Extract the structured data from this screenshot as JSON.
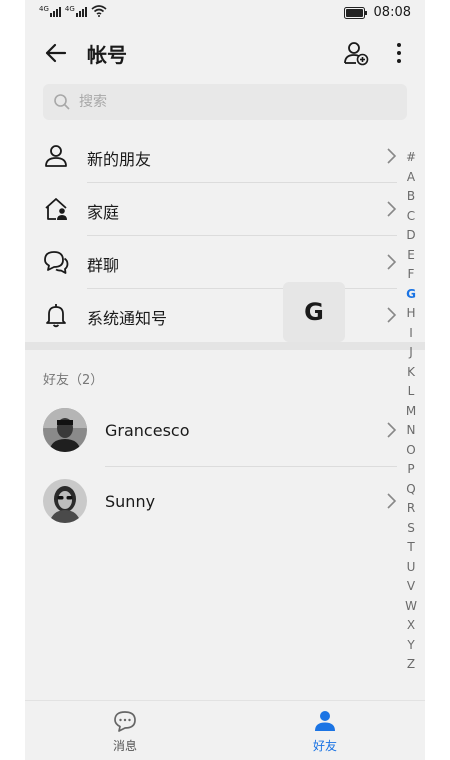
{
  "status_bar": {
    "signal1": "4G",
    "signal2": "4G",
    "time": "08:08"
  },
  "header": {
    "title": "帐号",
    "back_icon": "arrow-left-icon",
    "add_contact_icon": "add-contact-icon",
    "more_icon": "more-vert-icon"
  },
  "search": {
    "placeholder": "搜索",
    "value": ""
  },
  "shortcuts": [
    {
      "label": "新的朋友",
      "icon": "person-icon"
    },
    {
      "label": "家庭",
      "icon": "home-person-icon"
    },
    {
      "label": "群聊",
      "icon": "chat-bubbles-icon"
    },
    {
      "label": "系统通知号",
      "icon": "bell-icon"
    }
  ],
  "friends_header": "好友（2）",
  "friends": [
    {
      "name": "Grancesco",
      "avatar": "portrait-man-photo"
    },
    {
      "name": "Sunny",
      "avatar": "portrait-woman-sunglasses-photo"
    }
  ],
  "index_letters": [
    "#",
    "A",
    "B",
    "C",
    "D",
    "E",
    "F",
    "G",
    "H",
    "I",
    "J",
    "K",
    "L",
    "M",
    "N",
    "O",
    "P",
    "Q",
    "R",
    "S",
    "T",
    "U",
    "V",
    "W",
    "X",
    "Y",
    "Z"
  ],
  "index_active": "G",
  "index_popup": "G",
  "tabs": [
    {
      "label": "消息",
      "icon": "message-icon",
      "active": false
    },
    {
      "label": "好友",
      "icon": "person-filled-icon",
      "active": true
    }
  ],
  "colors": {
    "accent": "#1b74e4",
    "background": "#f1f1f1"
  }
}
